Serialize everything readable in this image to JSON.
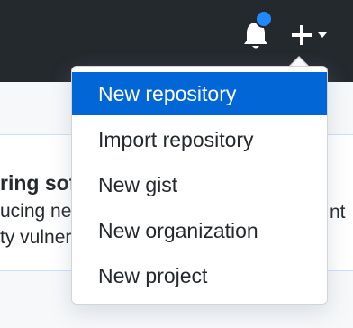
{
  "header": {
    "icons": [
      "bell-icon",
      "plus-icon",
      "caret-down-icon"
    ],
    "notification_color": "#2188ff"
  },
  "create_menu": {
    "items": [
      {
        "label": "New repository",
        "active": true
      },
      {
        "label": "Import repository"
      },
      {
        "label": "New gist"
      },
      {
        "label": "New organization"
      },
      {
        "label": "New project"
      }
    ],
    "highlight_color": "#0366d6"
  },
  "background_banner": {
    "title_fragment": "ring sof",
    "line1_fragment": "ucing ne",
    "line2_fragment": "ty vulner",
    "right_fragment": "nt"
  }
}
